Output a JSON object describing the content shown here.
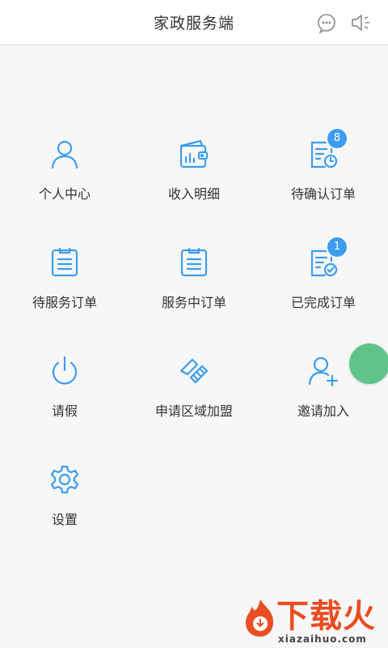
{
  "header": {
    "title": "家政服务端",
    "left_icon": "message-icon",
    "right_icon": "speaker-icon"
  },
  "colors": {
    "accent": "#3c9cf0",
    "badge": "#3c9cf0",
    "fab": "#5fc48a",
    "watermark": "#ea4d22"
  },
  "menu": [
    {
      "label": "个人中心",
      "icon": "person-icon"
    },
    {
      "label": "收入明细",
      "icon": "wallet-icon"
    },
    {
      "label": "待确认订单",
      "icon": "pending-confirm-icon",
      "badge": "8"
    },
    {
      "label": "待服务订单",
      "icon": "clipboard-icon"
    },
    {
      "label": "服务中订单",
      "icon": "clipboard-icon"
    },
    {
      "label": "已完成订单",
      "icon": "completed-order-icon",
      "badge": "1"
    },
    {
      "label": "请假",
      "icon": "power-icon"
    },
    {
      "label": "申请区域加盟",
      "icon": "handshake-icon"
    },
    {
      "label": "邀请加入",
      "icon": "add-user-icon"
    },
    {
      "label": "设置",
      "icon": "gear-icon"
    }
  ],
  "watermark": {
    "text": "下载火",
    "sub": "xiazaihuo.com"
  }
}
